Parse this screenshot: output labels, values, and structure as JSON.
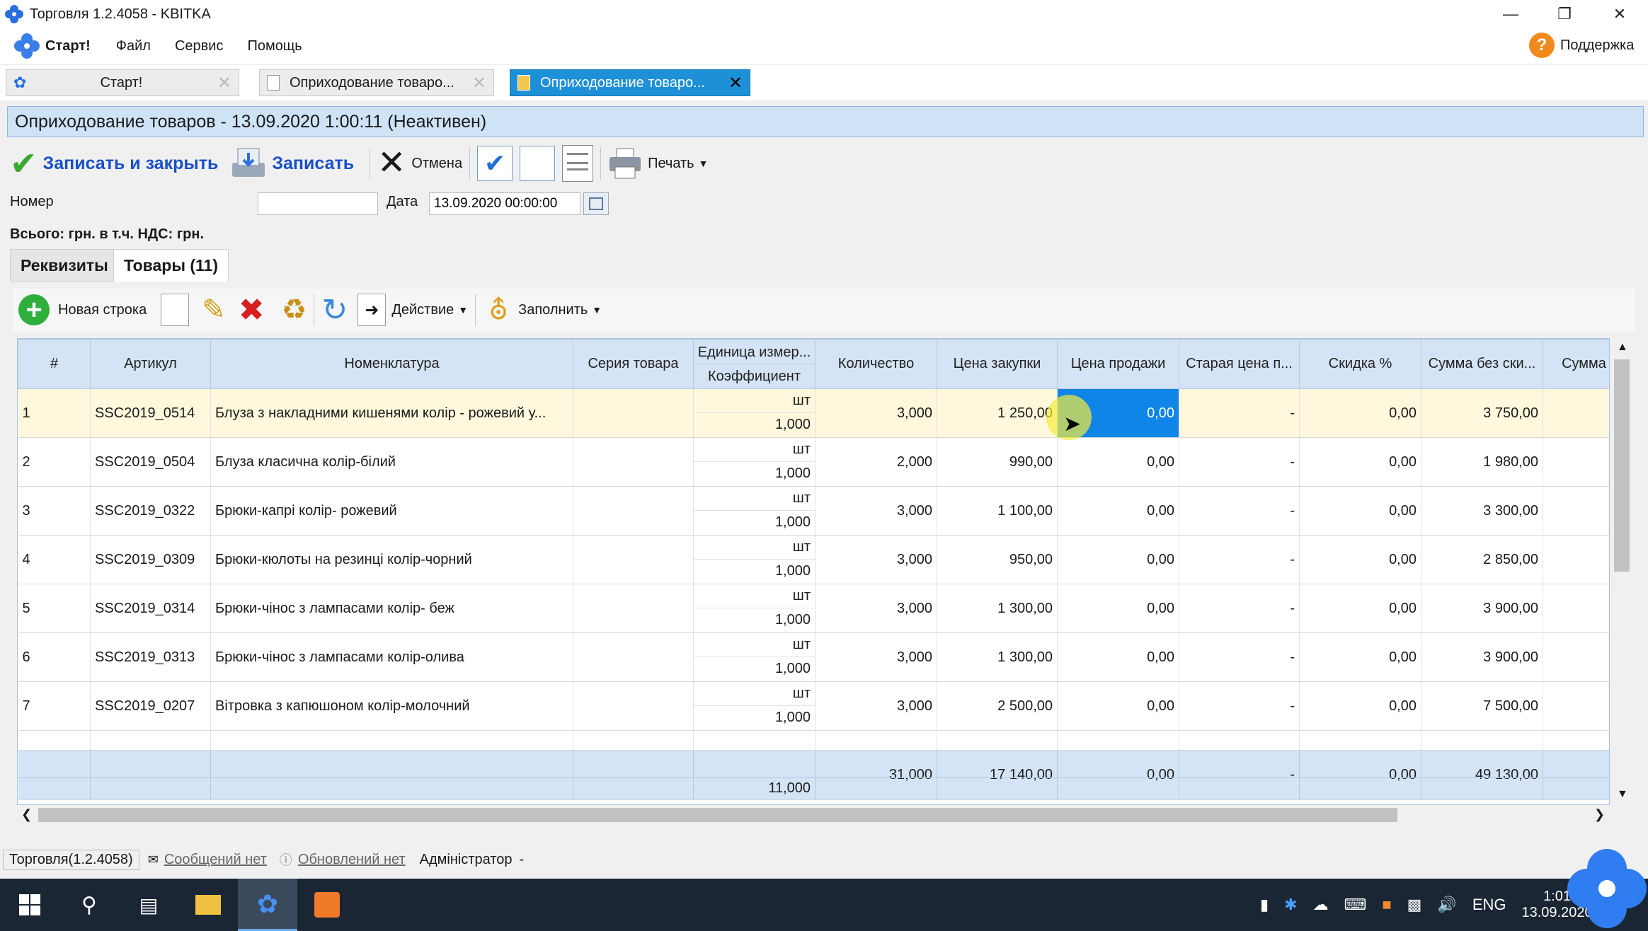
{
  "window": {
    "title": "Торговля 1.2.4058 - KBITKA"
  },
  "menu": {
    "start": "Старт!",
    "items": [
      "Файл",
      "Сервис",
      "Помощь"
    ],
    "support": "Поддержка"
  },
  "tabs": [
    {
      "label": "Старт!"
    },
    {
      "label": "Оприходование товаро..."
    },
    {
      "label": "Оприходование товаро..."
    }
  ],
  "doc": {
    "header": "Оприходование товаров  - 13.09.2020 1:00:11 (Неактивен)",
    "save_close": "Записать и закрыть",
    "save": "Записать",
    "cancel": "Отмена",
    "print": "Печать",
    "number_label": "Номер",
    "number_value": "",
    "date_label": "Дата",
    "date_value": "13.09.2020 00:00:00",
    "totals_line": "Всього: грн. в т.ч. НДС: грн."
  },
  "inner_tabs": {
    "requisites": "Реквизиты",
    "goods": "Товары (11)"
  },
  "grid_toolbar": {
    "new_row": "Новая строка",
    "action": "Действие",
    "fill": "Заполнить"
  },
  "grid": {
    "headers": {
      "num": "#",
      "sku": "Артикул",
      "name": "Номенклатура",
      "series": "Серия товара",
      "unit": "Единица измер...",
      "coef": "Коэффициент",
      "qty": "Количество",
      "buy": "Цена закупки",
      "sell": "Цена продажи",
      "old": "Старая цена п...",
      "disc": "Скидка %",
      "sum": "Сумма без ски...",
      "sum2": "Сумма"
    },
    "rows": [
      {
        "n": "1",
        "sku": "SSC2019_0514",
        "name": "Блуза з накладними кишенями колір - рожевий у...",
        "unit": "шт",
        "coef": "1,000",
        "qty": "3,000",
        "buy": "1 250,00",
        "sell": "0,00",
        "old": "-",
        "disc": "0,00",
        "sum": "3 750,00"
      },
      {
        "n": "2",
        "sku": "SSC2019_0504",
        "name": "Блуза класична колір-білий",
        "unit": "шт",
        "coef": "1,000",
        "qty": "2,000",
        "buy": "990,00",
        "sell": "0,00",
        "old": "-",
        "disc": "0,00",
        "sum": "1 980,00"
      },
      {
        "n": "3",
        "sku": "SSC2019_0322",
        "name": "Брюки-капрі колір- рожевий",
        "unit": "шт",
        "coef": "1,000",
        "qty": "3,000",
        "buy": "1 100,00",
        "sell": "0,00",
        "old": "-",
        "disc": "0,00",
        "sum": "3 300,00"
      },
      {
        "n": "4",
        "sku": "SSC2019_0309",
        "name": "Брюки-кюлоты на резинці колір-чорний",
        "unit": "шт",
        "coef": "1,000",
        "qty": "3,000",
        "buy": "950,00",
        "sell": "0,00",
        "old": "-",
        "disc": "0,00",
        "sum": "2 850,00"
      },
      {
        "n": "5",
        "sku": "SSC2019_0314",
        "name": "Брюки-чінос з лампасами колір- беж",
        "unit": "шт",
        "coef": "1,000",
        "qty": "3,000",
        "buy": "1 300,00",
        "sell": "0,00",
        "old": "-",
        "disc": "0,00",
        "sum": "3 900,00"
      },
      {
        "n": "6",
        "sku": "SSC2019_0313",
        "name": "Брюки-чінос з лампасами колір-олива",
        "unit": "шт",
        "coef": "1,000",
        "qty": "3,000",
        "buy": "1 300,00",
        "sell": "0,00",
        "old": "-",
        "disc": "0,00",
        "sum": "3 900,00"
      },
      {
        "n": "7",
        "sku": "SSC2019_0207",
        "name": "Вітровка з капюшоном колір-молочний",
        "unit": "шт",
        "coef": "1,000",
        "qty": "3,000",
        "buy": "2 500,00",
        "sell": "0,00",
        "old": "-",
        "disc": "0,00",
        "sum": "7 500,00"
      }
    ],
    "totals": {
      "coef": "11,000",
      "qty": "31,000",
      "buy": "17 140,00",
      "sell": "0,00",
      "old": "-",
      "disc": "0,00",
      "sum": "49 130,00"
    }
  },
  "status": {
    "app": "Торговля(1.2.4058)",
    "messages": "Сообщений нет",
    "updates": "Обновлений нет",
    "user": "Адміністратор",
    "dash": "-"
  },
  "taskbar": {
    "lang": "ENG",
    "time": "1:01",
    "date": "13.09.2020"
  },
  "colors": {
    "accent": "#1e90d8",
    "header_bg": "#cfe3f7",
    "selected_row": "#fff8dc",
    "focus_cell": "#0f85e8"
  }
}
